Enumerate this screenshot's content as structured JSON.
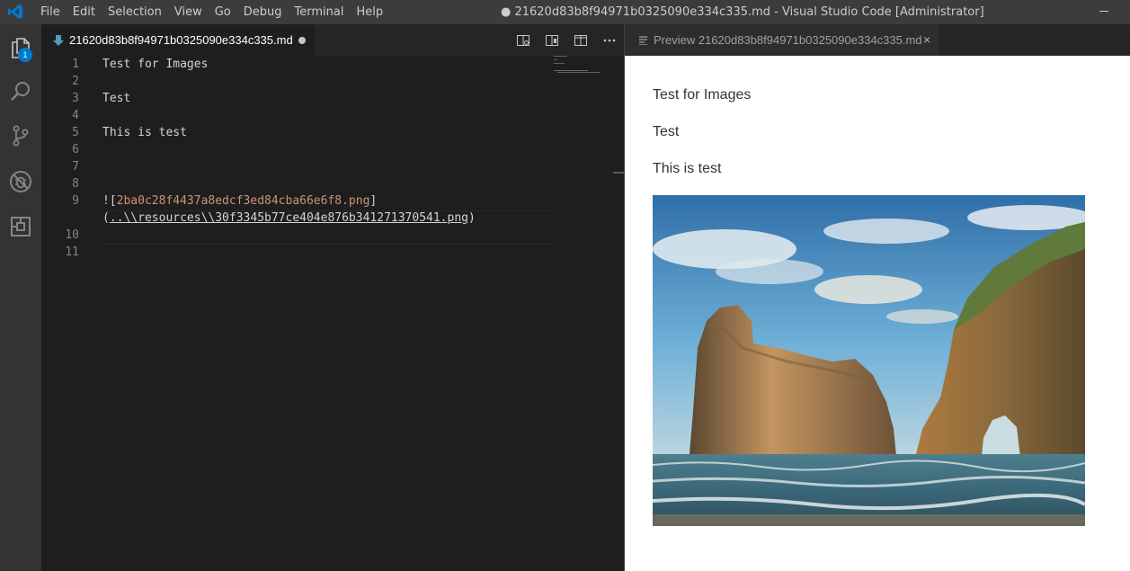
{
  "titlebar": {
    "menu": [
      "File",
      "Edit",
      "Selection",
      "View",
      "Go",
      "Debug",
      "Terminal",
      "Help"
    ],
    "window_title": "● 21620d83b8f94971b0325090e334c335.md - Visual Studio Code [Administrator]"
  },
  "activity_bar": {
    "explorer_badge": "1",
    "icons": [
      "files-icon",
      "search-icon",
      "source-control-icon",
      "debug-icon",
      "extensions-icon"
    ]
  },
  "editor": {
    "tab": {
      "filename": "21620d83b8f94971b0325090e334c335.md",
      "dirty": true
    },
    "lines": [
      {
        "num": "1",
        "text": "Test for Images"
      },
      {
        "num": "2",
        "text": ""
      },
      {
        "num": "3",
        "text": "Test"
      },
      {
        "num": "4",
        "text": ""
      },
      {
        "num": "5",
        "text": "This is test"
      },
      {
        "num": "6",
        "text": ""
      },
      {
        "num": "7",
        "text": ""
      },
      {
        "num": "8",
        "text": ""
      },
      {
        "num": "9",
        "prefix": "![",
        "link_text": "2ba0c28f4437a8edcf3ed84cba66e6f8.png",
        "suffix": "]"
      },
      {
        "num": "",
        "open": "(",
        "url": "..\\\\resources\\\\30f3345b77ce404e876b341271370541.png",
        "close": ")"
      },
      {
        "num": "10",
        "text": ""
      },
      {
        "num": "11",
        "text": ""
      }
    ]
  },
  "preview": {
    "tab_label": "Preview 21620d83b8f94971b0325090e334c335.md",
    "paragraphs": [
      "Test for Images",
      "Test",
      "This is test"
    ],
    "image_description": "coastal rock arches landscape"
  },
  "colors": {
    "accent": "#007acc",
    "editor_bg": "#1e1e1e",
    "link_text": "#ce9178"
  }
}
